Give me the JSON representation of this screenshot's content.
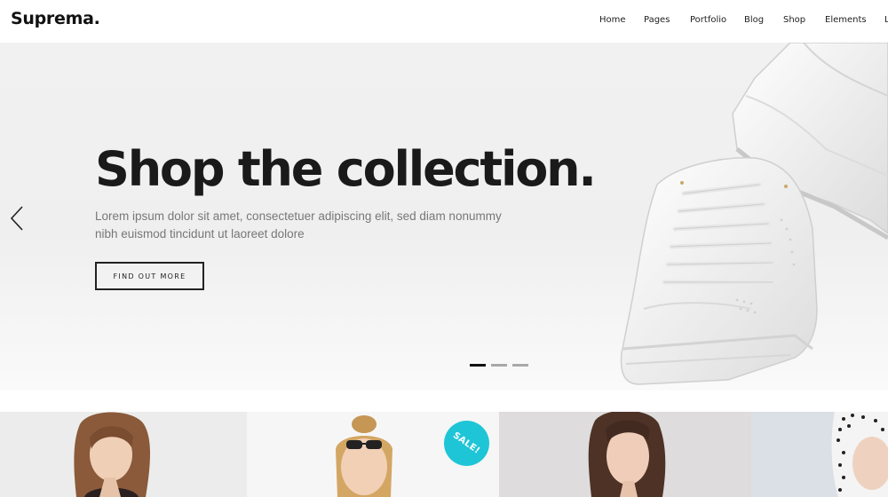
{
  "header": {
    "logo": "Suprema.",
    "nav": [
      "Home",
      "Pages",
      "Portfolio",
      "Blog",
      "Shop",
      "Elements",
      "L"
    ]
  },
  "hero": {
    "title": "Shop the collection.",
    "description": "Lorem ipsum dolor sit amet, consectetuer adipiscing elit, sed diam nonummy nibh euismod tincidunt ut laoreet dolore",
    "cta_label": "FIND OUT MORE",
    "slides_total": 3,
    "active_slide": 1
  },
  "products": {
    "badge": "SALE!"
  },
  "colors": {
    "badge": "#1ec5d6",
    "text_dark": "#1a1a1a",
    "text_muted": "#777777"
  },
  "icons": [
    "chevron-left-icon"
  ]
}
